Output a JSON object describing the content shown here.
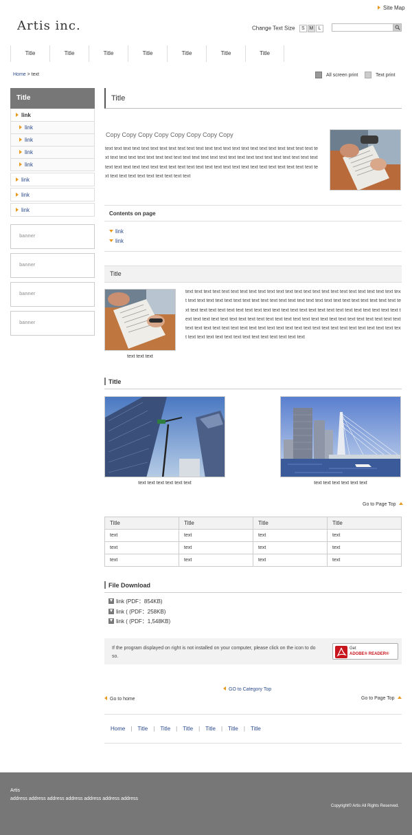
{
  "header": {
    "logo": "Artis inc.",
    "sitemap": "Site Map",
    "text_size_label": "Change Text Size",
    "sizes": [
      "S",
      "M",
      "L"
    ],
    "search_placeholder": ""
  },
  "gnav": [
    "Title",
    "Title",
    "Title",
    "Title",
    "Title",
    "Title",
    "Title"
  ],
  "breadcrumb": {
    "home": "Home",
    "sep": " > ",
    "current": "text"
  },
  "print": {
    "screen": "All screen print",
    "text": "Text print"
  },
  "sidebar": {
    "title": "Title",
    "items": [
      {
        "label": "link",
        "level": "top"
      },
      {
        "label": "link",
        "level": "sub"
      },
      {
        "label": "link",
        "level": "sub"
      },
      {
        "label": "link",
        "level": "sub"
      },
      {
        "label": "link",
        "level": "sub"
      },
      {
        "label": "link",
        "level": "main"
      },
      {
        "label": "link",
        "level": "main"
      },
      {
        "label": "link",
        "level": "main"
      }
    ],
    "banners": [
      "banner",
      "banner",
      "banner",
      "banner"
    ]
  },
  "main": {
    "title": "Title",
    "copy": "Copy Copy Copy Copy Copy Copy Copy Copy",
    "intro_text": "text text text text text text text text text text text text text text text text text text text text text text text text text text text text text text text text text text text text text text text text text text text text text text text text text text text text text text text text text text text text text text text text text text text text text text text text text text text text text text text text",
    "contents": {
      "heading": "Contents on page",
      "links": [
        "link",
        "link"
      ]
    },
    "section1": {
      "title": "Title",
      "caption": "text text text",
      "text": "text text text text text text text text text text text text text text text text text text text text text text text text text text text text text text text text text text text text text text text text text text text text text text text text text text text text text text text text text text text text text text text text text text text text text text text text text text text text text text text text text text text text text text text text text text text text text text text text text text text text text text text text text text text text text text text text text text text text text text text text text text text text text text text text text text text text"
    },
    "section2": {
      "title": "Title",
      "captions": [
        "text text text text text text",
        "text text text text text text"
      ]
    },
    "page_top": "Go to Page Top",
    "table": {
      "headers": [
        "Title",
        "Title",
        "Title",
        "Title"
      ],
      "rows": [
        [
          "text",
          "text",
          "text",
          "text"
        ],
        [
          "text",
          "text",
          "text",
          "text"
        ],
        [
          "text",
          "text",
          "text",
          "text"
        ]
      ]
    },
    "downloads": {
      "title": "File Download",
      "items": [
        "link (PDF：854KB)",
        "link ( (PDF：258KB)",
        "link ( (PDF：1,548KB)"
      ]
    },
    "reader": {
      "text": "If the program displayed on right is not installed on your computer, please click on the icon to do so.",
      "button_get": "Get",
      "button_name": "ADOBE® READER®"
    },
    "category_top": "GO to Category Top",
    "go_home": "Go to home",
    "bottom_nav": [
      "Home",
      "Title",
      "Title",
      "Title",
      "Title",
      "Title",
      "Title"
    ]
  },
  "footer": {
    "name": "Artis",
    "address": "address address address address address address address",
    "copyright": "Copyright© Artis All Rights Reserved."
  }
}
